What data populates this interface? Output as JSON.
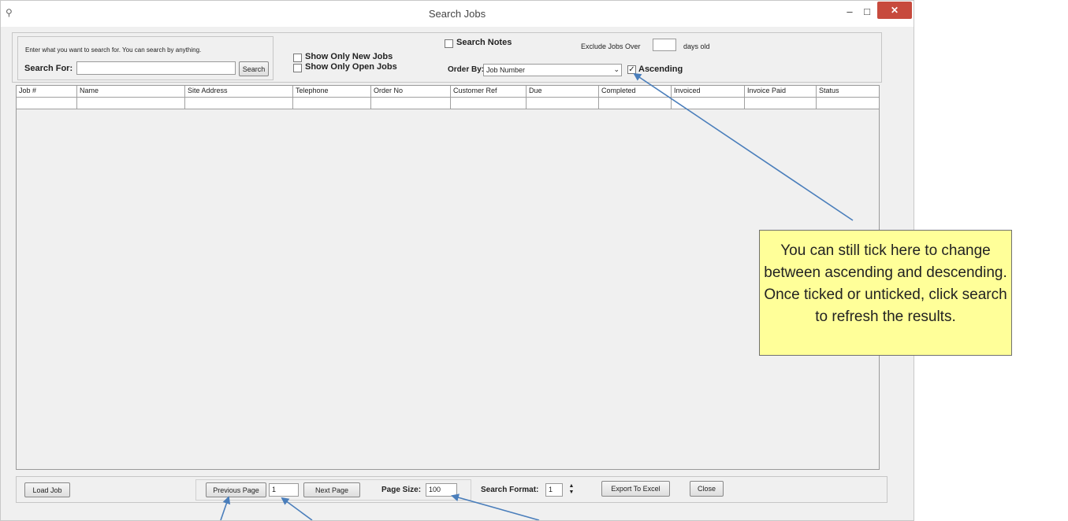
{
  "window": {
    "title": "Search Jobs",
    "icon": "key-icon",
    "minimize_glyph": "–",
    "maximize_glyph": "□",
    "close_glyph": "✕"
  },
  "search_panel": {
    "hint": "Enter what you want to search for. You can search by anything.",
    "search_for_label": "Search For:",
    "search_value": "",
    "search_button": "Search"
  },
  "filters": {
    "show_only_new_jobs": {
      "label": "Show Only New Jobs",
      "checked": false
    },
    "show_only_open_jobs": {
      "label": "Show Only Open Jobs",
      "checked": false
    },
    "search_notes": {
      "label": "Search Notes",
      "checked": false
    },
    "exclude_jobs_prefix": "Exclude Jobs Over",
    "exclude_jobs_value": "",
    "exclude_jobs_suffix": "days old",
    "order_by_label": "Order By:",
    "order_by_value": "Job Number",
    "ascending": {
      "label": "Ascending",
      "checked": true,
      "check_glyph": "✓"
    }
  },
  "grid": {
    "columns": [
      "Job #",
      "Name",
      "Site Address",
      "Telephone",
      "Order No",
      "Customer Ref",
      "Due",
      "Completed",
      "Invoiced",
      "Invoice Paid",
      "Status"
    ]
  },
  "footer": {
    "load_job": "Load Job",
    "previous_page": "Previous Page",
    "page_number": "1",
    "next_page": "Next Page",
    "page_size_label": "Page Size:",
    "page_size_value": "100",
    "search_format_label": "Search Format:",
    "search_format_value": "1",
    "export_to_excel": "Export To Excel",
    "close": "Close"
  },
  "callout": {
    "text": "You can still tick here to change between ascending and descending. Once ticked or unticked, click search to refresh the results.",
    "color": "#ffff99"
  },
  "colors": {
    "window_bg": "#f0f0f0",
    "close_button": "#c74a3d",
    "arrow": "#4a7ebb"
  }
}
